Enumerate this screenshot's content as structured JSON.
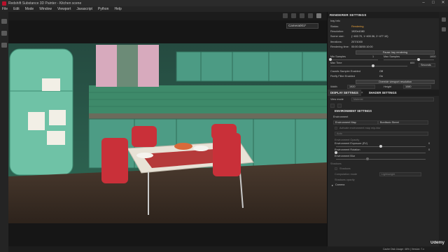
{
  "window": {
    "title": "Redshift Substance 3D Painter - Kitchen scene",
    "controls": [
      "–",
      "□",
      "✕"
    ]
  },
  "menu": [
    "File",
    "Edit",
    "Mode",
    "Window",
    "Viewport",
    "Javascript",
    "Python",
    "Help"
  ],
  "viewport": {
    "camera_select": "Camera001*"
  },
  "render_settings": {
    "header": "RENDERER SETTINGS",
    "section": "Iray Info",
    "info": [
      {
        "k": "Status:",
        "v": "Rendering",
        "highlight": true
      },
      {
        "k": "Resolution:",
        "v": "1920x1080"
      },
      {
        "k": "Scene size:",
        "v": "(−402.70, 1−400.36, 2−477.10)"
      },
      {
        "k": "Iterations:",
        "v": "207/1000"
      },
      {
        "k": "Rendering time:",
        "v": "00:00:38/00:10:00"
      }
    ],
    "pause_label": "Pause Iray rendering",
    "min_samples_label": "Min Samples",
    "min_samples_value": "1",
    "max_samples_label": "Max Samples",
    "max_samples_value": "1000",
    "max_time_label": "Max Time",
    "max_time_value": "600",
    "max_time_unit": "Seconds",
    "caustic_label": "Caustic Sampler Enabled",
    "caustic_value": "Off",
    "firefly_label": "Firefly Filter Enabled",
    "firefly_value": "On",
    "override_label": "Override viewport resolution",
    "width_label": "Width",
    "width_value": "1920",
    "height_label": "Height",
    "height_value": "1080",
    "levels": {
      "min_samples": 0.0,
      "max_samples": 0.7,
      "max_time": 0.55
    }
  },
  "display_settings": {
    "tabs": [
      "DISPLAY SETTINGS",
      "SHADER SETTINGS"
    ],
    "view_mode_label": "View mode",
    "view_mode_value": "Material",
    "env_title": "ENVIRONMENT SETTINGS",
    "environment_label": "Environment",
    "env_map_label": "Environment Map",
    "env_map_value": "Bonifacio Street",
    "env_blur_label": "Activate environment map mip-blur",
    "env_auto_label": "Auto",
    "opacity_label": "Environment Opacity",
    "exposure_label": "Environment Exposure (EV)",
    "exposure_value": "0",
    "rotation_label": "Environment Rotation",
    "rotation_value": "0",
    "blur_label": "Environment Blur",
    "shadows_label": "Shadows",
    "shadows_check_label": "Shadows",
    "computation_label": "Computation mode",
    "computation_value": "Lightweight",
    "shadows_opacity_label": "Shadows opacity",
    "camera_label": "Camera",
    "levels": {
      "exposure": 0.5,
      "rotation": 0.0,
      "blur": 0.35
    }
  },
  "footer": {
    "cache": "Cache Disk Usage: 46% | Version: 7.x"
  },
  "watermark": "Udemy",
  "colors": {
    "accent_status": "#e9a23b",
    "panel_bg": "#262626"
  }
}
